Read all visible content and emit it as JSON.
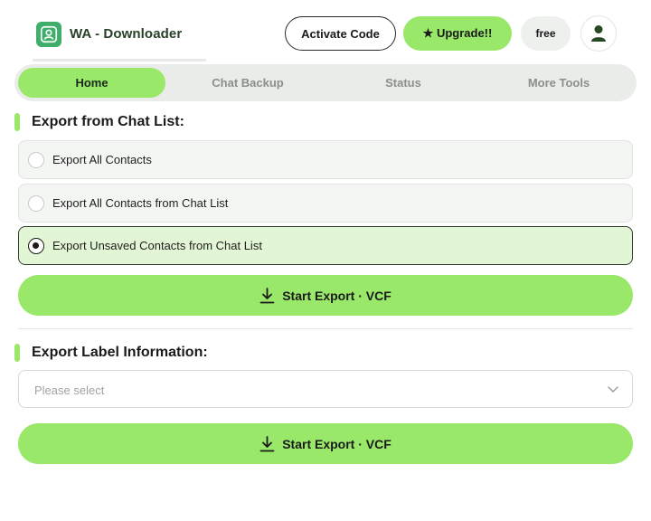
{
  "header": {
    "app_title": "WA - Downloader",
    "logo_icon": "user-badge-icon",
    "activate_label": "Activate Code",
    "upgrade_label": "★ Upgrade!!",
    "plan_badge": "free",
    "avatar_icon": "user-icon"
  },
  "tabs": [
    {
      "label": "Home",
      "active": true
    },
    {
      "label": "Chat Backup",
      "active": false
    },
    {
      "label": "Status",
      "active": false
    },
    {
      "label": "More Tools",
      "active": false
    }
  ],
  "chat_list_section": {
    "title": "Export from Chat List:",
    "options": [
      {
        "label": "Export All Contacts",
        "selected": false
      },
      {
        "label": "Export All Contacts from Chat List",
        "selected": false
      },
      {
        "label": "Export Unsaved Contacts from Chat List",
        "selected": true
      }
    ],
    "export_label": "Start Export · VCF"
  },
  "label_section": {
    "title": "Export Label Information:",
    "select_placeholder": "Please select",
    "export_label": "Start Export · VCF"
  },
  "colors": {
    "accent": "#99e86a",
    "selected_bg": "#e2f6d6",
    "tab_bg": "#eaecea",
    "logo_bg": "#3fae6a"
  }
}
